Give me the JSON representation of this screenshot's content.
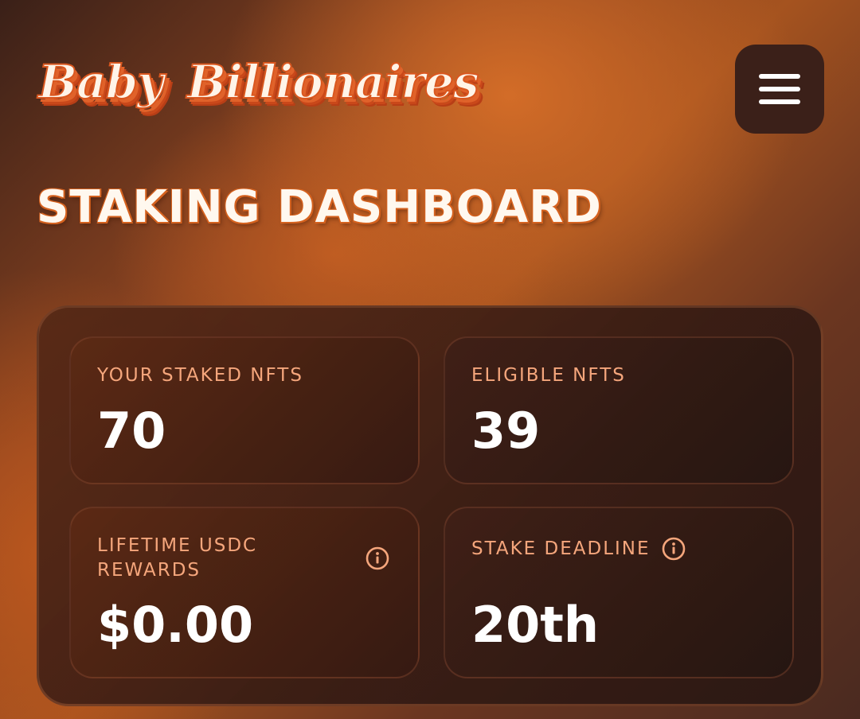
{
  "header": {
    "logo_word_1": "Baby",
    "logo_word_2": "Billionaires"
  },
  "page": {
    "title": "STAKING DASHBOARD"
  },
  "stats": {
    "staked": {
      "label": "YOUR STAKED NFTS",
      "value": "70"
    },
    "eligible": {
      "label": "ELIGIBLE NFTS",
      "value": "39"
    },
    "rewards": {
      "label": "LIFETIME USDC REWARDS",
      "value": "$0.00"
    },
    "deadline": {
      "label": "STAKE DEADLINE",
      "value": "20th"
    }
  },
  "icons": {
    "menu": "hamburger-menu-icon",
    "info": "info-circle-icon"
  },
  "colors": {
    "accent": "#e0622a",
    "label": "#f5a67c",
    "value": "#ffffff",
    "panel": "#3a2018"
  }
}
